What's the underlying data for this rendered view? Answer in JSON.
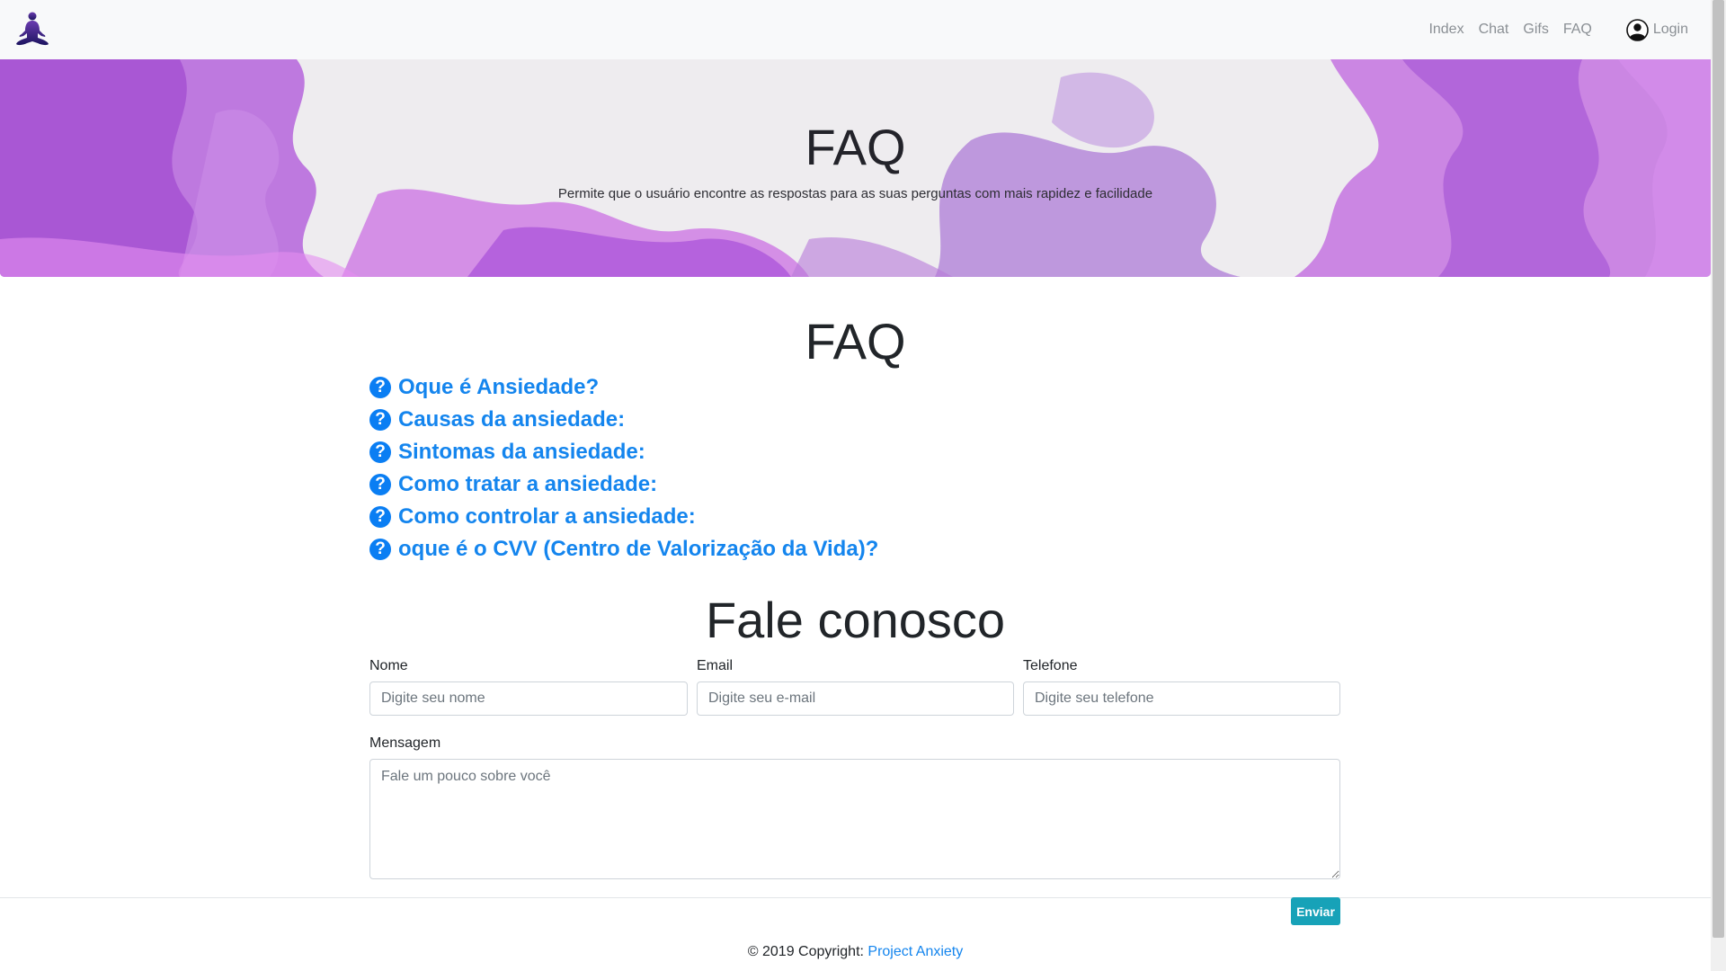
{
  "navbar": {
    "logo_alt": "meditation-logo",
    "links": [
      "Index",
      "Chat",
      "Gifs",
      "FAQ"
    ],
    "login_label": "Login"
  },
  "hero": {
    "title": "FAQ",
    "subtitle": "Permite que o usuário encontre as respostas para as suas perguntas com mais rapidez e facilidade"
  },
  "faq": {
    "title": "FAQ",
    "items": [
      "Oque é Ansiedade?",
      "Causas da ansiedade:",
      "Sintomas da ansiedade:",
      "Como tratar a ansiedade:",
      "Como controlar a ansiedade:",
      "oque é o CVV (Centro de Valorização da Vida)?"
    ]
  },
  "contact": {
    "title": "Fale conosco",
    "name_label": "Nome",
    "name_placeholder": "Digite seu nome",
    "email_label": "Email",
    "email_placeholder": "Digite seu e-mail",
    "phone_label": "Telefone",
    "phone_placeholder": "Digite seu telefone",
    "message_label": "Mensagem",
    "message_placeholder": "Fale um pouco sobre você",
    "submit_label": "Enviar"
  },
  "footer": {
    "copyright_prefix": "© 2019 Copyright: ",
    "copyright_link": "Project Anxiety"
  },
  "colors": {
    "accent_blue": "#1485ee",
    "button_teal": "#17a2b8",
    "hero_purple": "#b56ee0"
  }
}
